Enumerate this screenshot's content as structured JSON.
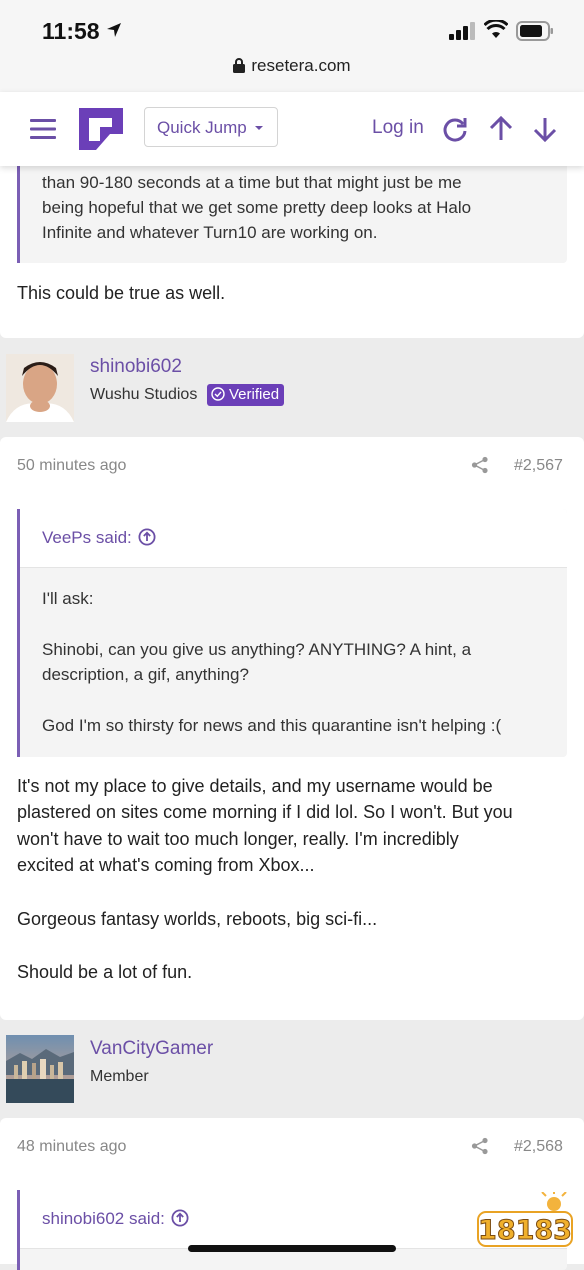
{
  "status_bar": {
    "time": "11:58",
    "url": "resetera.com"
  },
  "header": {
    "quick_jump": "Quick Jump",
    "login": "Log in"
  },
  "post1": {
    "quote_lines": [
      "than 90-180 seconds at a time but that might just be me",
      "being hopeful that we get some pretty deep looks at Halo",
      "Infinite and whatever Turn10 are working on."
    ],
    "reply": "This could be true as well."
  },
  "post2": {
    "username": "shinobi602",
    "user_title": "Wushu Studios",
    "badge": "Verified",
    "time": "50 minutes ago",
    "post_number": "#2,567",
    "quote_author": "VeePs said:",
    "quote_lines": [
      "I'll ask:",
      "",
      "Shinobi, can you give us anything? ANYTHING? A hint, a",
      "description, a gif, anything?",
      "",
      "God I'm so thirsty for news and this quarantine isn't helping :("
    ],
    "body_lines": [
      "It's not my place to give details, and my username would be",
      "plastered on sites come morning if I did lol. So I won't. But you",
      "won't have to wait too much longer, really. I'm incredibly",
      "excited at what's coming from Xbox...",
      "",
      "Gorgeous fantasy worlds, reboots, big sci-fi...",
      "",
      "Should be a lot of fun."
    ]
  },
  "post3": {
    "username": "VanCityGamer",
    "user_title": "Member",
    "time": "48 minutes ago",
    "post_number": "#2,568",
    "quote_author": "shinobi602 said:"
  },
  "watermark": "18183",
  "colors": {
    "accent": "#6b4fa6",
    "badge": "#6b3fb8"
  }
}
